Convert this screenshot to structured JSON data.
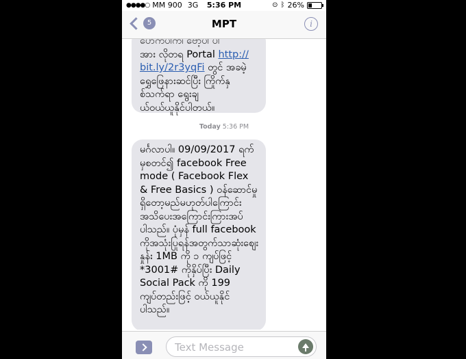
{
  "status": {
    "signal_dots": "●●●●○",
    "carrier": "MM 900",
    "network": "3G",
    "time": "5:36 PM",
    "battery": "26%",
    "battery_level": 0.26
  },
  "nav": {
    "back_badge": "5",
    "title": "MPT",
    "info_icon": "i"
  },
  "messages": {
    "first_lines": [
      "ပ်ောက်ပါက်၊ ဗော့ပါ ပါ",
      "အား လိုတရ Portal http://",
      "bit.ly/2r3yqFi တွင် အခမဲ့",
      "ရွှေဖြေနားဆင်ပြီး ကြိုက်နှ",
      "စ်သက်ရာ ရွေးချ",
      "ယ်ဝယ်ယူနိုင်ပါတယ်။"
    ],
    "link_text": "http://",
    "link_text2": "bit.ly/2r3yqFi",
    "timestamp_day": "Today",
    "timestamp_time": "5:36 PM",
    "second": "မင်္ဂလာပါ။ 09/09/2017 ရက်မှစတင်၍ facebook Free mode ( Facebook Flex & Free Basics ) ဝန်ဆောင်မှုရှိတော့မည်မဟုတ်ပါကြောင်းအသိပေးအကြောင်းကြားအပ်ပါသည်။ ပုံမှန် full facebook ကိုအသုံးပြုရန်အတွက်သာဆုံးစျေးနှုန်း 1MB ကို ၁ ကျပ်ဖြင့် *3001# ကိုနှိပ်ပြီး Daily Social Pack ကို 199 ကျပ်တည်းဖြင့် ဝယ်ယူနိုင်ပါသည်။"
  },
  "input": {
    "placeholder": "Text Message"
  },
  "colors": {
    "accent": "#8a8fb5",
    "bubble": "#e5e5ea",
    "send": "#6b7b6b"
  }
}
